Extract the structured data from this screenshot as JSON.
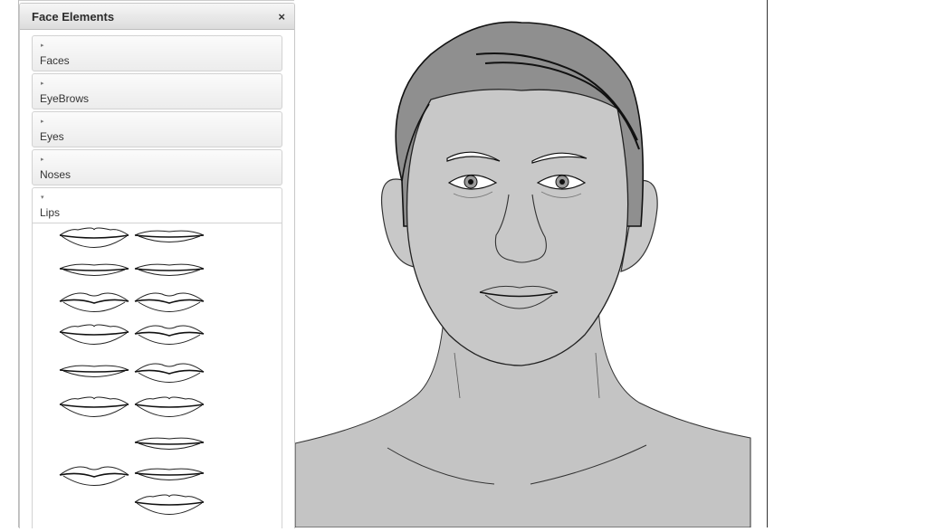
{
  "panel": {
    "title": "Face Elements",
    "close_label": "×",
    "sections": [
      {
        "label": "Faces",
        "expanded": false
      },
      {
        "label": "EyeBrows",
        "expanded": false
      },
      {
        "label": "Eyes",
        "expanded": false
      },
      {
        "label": "Noses",
        "expanded": false
      },
      {
        "label": "Lips",
        "expanded": true
      }
    ],
    "arrow_collapsed": "▸",
    "arrow_expanded": "▾"
  },
  "colors": {
    "skin": "#c8c8c8",
    "hair": "#8f8f8f",
    "panel_header": "#dcdcdc",
    "line": "#222222"
  }
}
